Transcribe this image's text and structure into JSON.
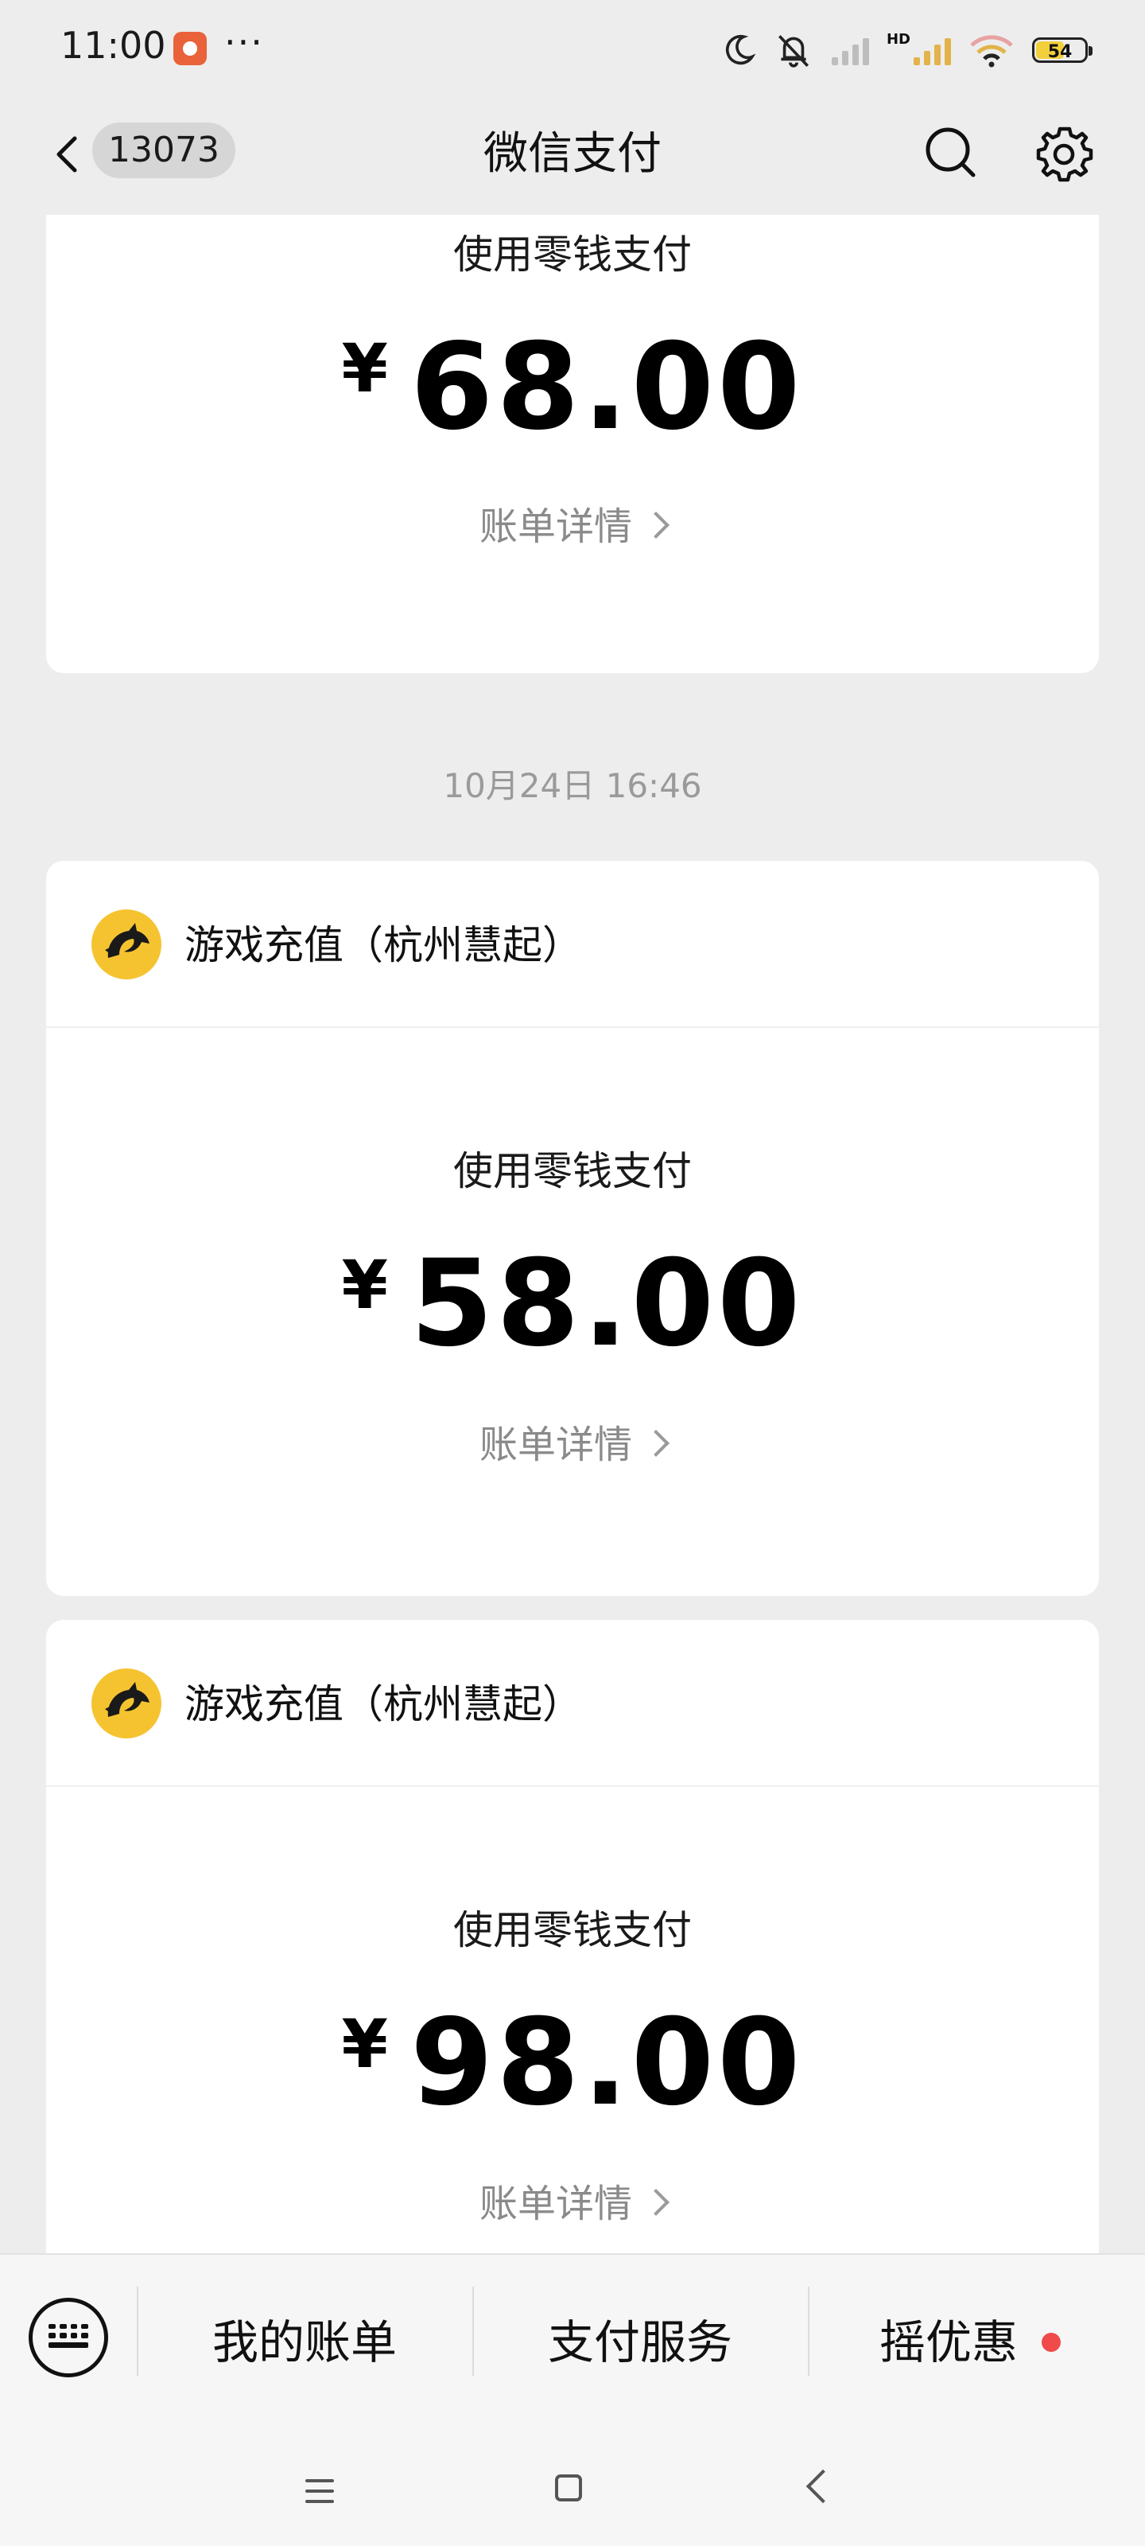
{
  "status_bar": {
    "time": "11:00",
    "more": "···",
    "signal_label": "HD",
    "battery": "54"
  },
  "nav": {
    "badge": "13073",
    "title": "微信支付"
  },
  "entries": [
    {
      "merchant": "",
      "pay_method": "使用零钱支付",
      "yen": "¥",
      "amount": "68.00",
      "detail": "账单详情"
    },
    {
      "merchant": "游戏充值（杭州慧起）",
      "pay_method": "使用零钱支付",
      "yen": "¥",
      "amount": "58.00",
      "detail": "账单详情"
    },
    {
      "merchant": "游戏充值（杭州慧起）",
      "pay_method": "使用零钱支付",
      "yen": "¥",
      "amount": "98.00",
      "detail": "账单详情"
    }
  ],
  "timestamp": "10月24日 16:46",
  "bottom_menu": {
    "items": [
      "我的账单",
      "支付服务",
      "摇优惠"
    ]
  },
  "colors": {
    "page_bg": "#ededed",
    "card_bg": "#ffffff",
    "red_dot": "#f04a4a",
    "logo_yellow": "#f5c330"
  }
}
